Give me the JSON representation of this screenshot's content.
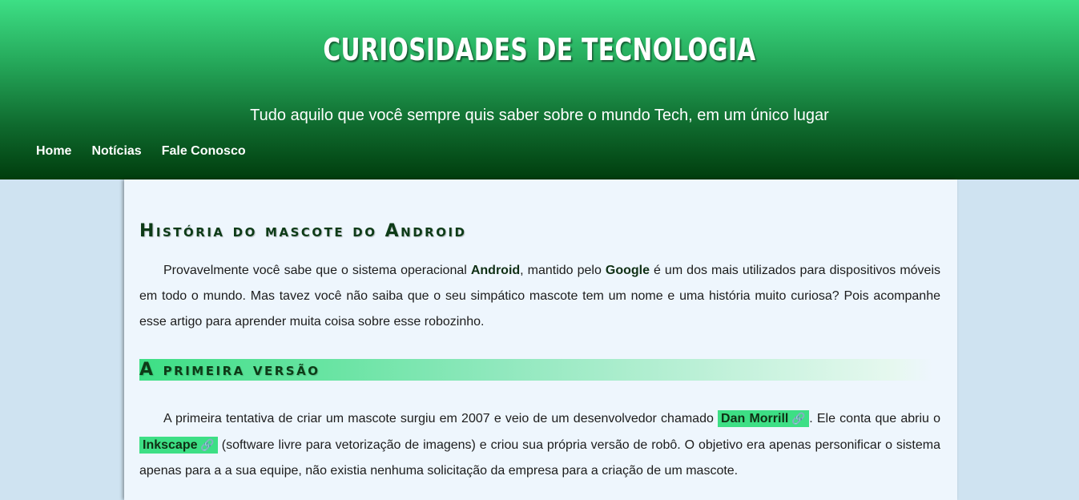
{
  "header": {
    "title": "CURIOSIDADES DE TECNOLOGIA",
    "subtitle": "Tudo aquilo que você sempre quis saber sobre o mundo Tech, em um único lugar"
  },
  "nav": {
    "items": [
      {
        "label": "Home"
      },
      {
        "label": "Notícias"
      },
      {
        "label": "Fale Conosco"
      }
    ]
  },
  "article": {
    "title": "História do mascote do Android",
    "intro": {
      "t1": "Provavelmente você sabe que o sistema operacional ",
      "b1": "Android",
      "t2": ", mantido pelo ",
      "b2": "Google",
      "t3": " é um dos mais utilizados para dispositivos móveis em todo o mundo. Mas tavez você não saiba que o seu simpático mascote tem um nome e uma história muito curiosa? Pois acompanhe esse artigo para aprender muita coisa sobre esse robozinho."
    },
    "section1": {
      "title": "A primeira versão",
      "t1": "A primeira tentativa de criar um mascote surgiu em 2007 e veio de um desenvolvedor chamado ",
      "link1": "Dan Morrill",
      "t2": ". Ele conta que abriu o ",
      "link2": "Inkscape",
      "t3": " (software livre para vetorização de imagens) e criou sua própria versão de robô. O objetivo era apenas personificar o sistema apenas para a a sua equipe, não existia nenhuma solicitação da empresa para a criação de um mascote."
    }
  },
  "icons": {
    "link": "link-icon"
  },
  "colors": {
    "accent": "#3ddf85",
    "header_dark": "#003d0d",
    "page_bg": "#cfe3f1",
    "article_bg": "#eef6fd"
  }
}
